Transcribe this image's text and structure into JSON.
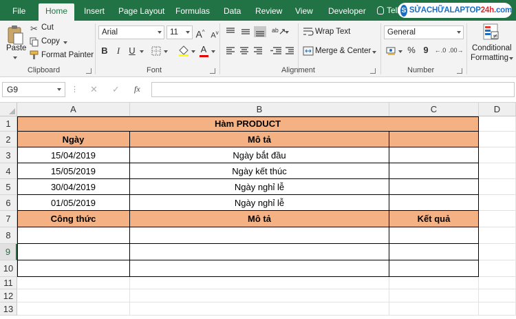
{
  "tabs": [
    "File",
    "Home",
    "Insert",
    "Page Layout",
    "Formulas",
    "Data",
    "Review",
    "View",
    "Developer"
  ],
  "tell_me": "Tell",
  "logo": {
    "text_blue": "SỬACHỮALAPTOP",
    "text_red": "24h",
    "text_tail": ".com"
  },
  "ribbon": {
    "clipboard": {
      "paste": "Paste",
      "cut": "Cut",
      "copy": "Copy",
      "format_painter": "Format Painter",
      "label": "Clipboard"
    },
    "font": {
      "name": "Arial",
      "size": "11",
      "bold": "B",
      "italic": "I",
      "underline": "U",
      "grow": "A",
      "shrink": "A",
      "label": "Font"
    },
    "alignment": {
      "wrap_text": "Wrap Text",
      "merge_center": "Merge & Center",
      "label": "Alignment"
    },
    "number": {
      "format": "General",
      "percent": "%",
      "comma": "9",
      "label": "Number"
    },
    "styles": {
      "conditional": "Conditional",
      "formatting": "Formatting"
    }
  },
  "formula_bar": {
    "name_box": "G9",
    "fx": "fx",
    "cancel": "✕",
    "enter": "✓",
    "formula": ""
  },
  "columns": [
    "A",
    "B",
    "C",
    "D"
  ],
  "rows": [
    "1",
    "2",
    "3",
    "4",
    "5",
    "6",
    "7",
    "8",
    "9",
    "10",
    "11",
    "12",
    "13"
  ],
  "sheet": {
    "title": "Hàm PRODUCT",
    "header1": [
      "Ngày",
      "Mô tả",
      ""
    ],
    "data": [
      [
        "15/04/2019",
        "Ngày bắt đầu"
      ],
      [
        "15/05/2019",
        "Ngày kết thúc"
      ],
      [
        "30/04/2019",
        "Ngày nghỉ lễ"
      ],
      [
        "01/05/2019",
        "Ngày nghỉ lễ"
      ]
    ],
    "header2": [
      "Công thức",
      "Mô tả",
      "Kết quả"
    ]
  },
  "colors": {
    "accent": "#217346",
    "header_fill": "#f4b183"
  }
}
